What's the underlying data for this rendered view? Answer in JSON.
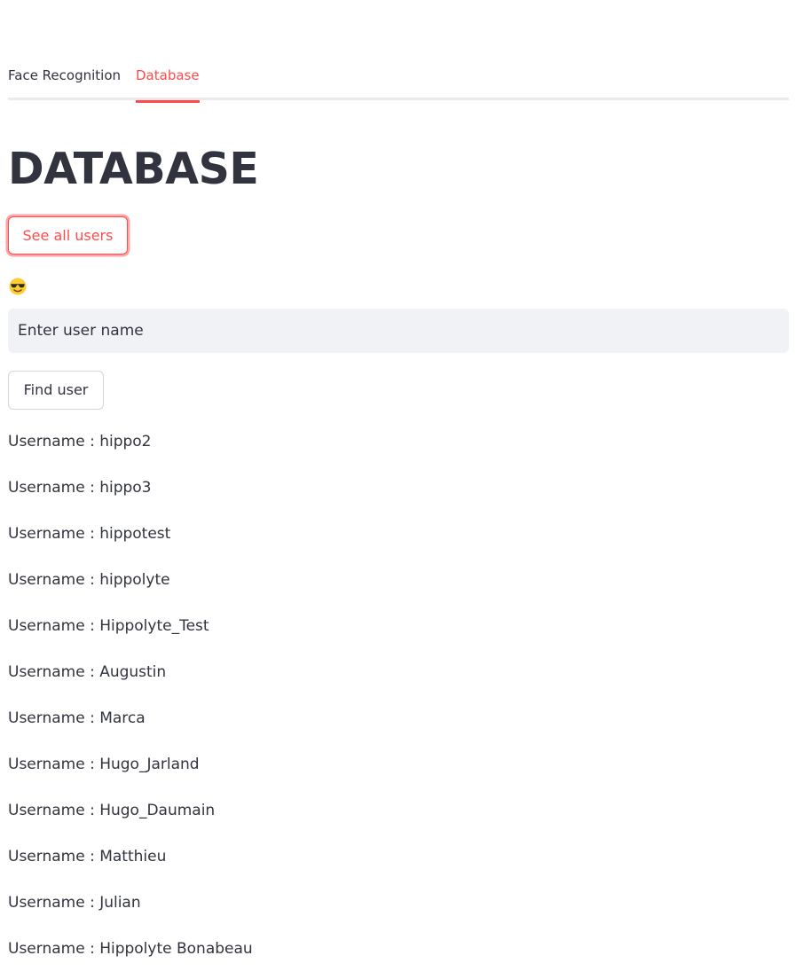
{
  "tabs": [
    {
      "label": "Face Recognition",
      "active": false
    },
    {
      "label": "Database",
      "active": true
    }
  ],
  "page": {
    "title": "DATABASE",
    "see_all_label": "See all users",
    "status_emoji_icon": "sunglasses-face-icon",
    "search_placeholder": "Enter user name",
    "search_value": "",
    "find_label": "Find user"
  },
  "users": [
    "Username : hippo2",
    "Username : hippo3",
    "Username : hippotest",
    "Username : hippolyte",
    "Username : Hippolyte_Test",
    "Username : Augustin",
    "Username : Marca",
    "Username : Hugo_Jarland",
    "Username : Hugo_Daumain",
    "Username : Matthieu",
    "Username : Julian",
    "Username : Hippolyte Bonabeau"
  ],
  "colors": {
    "accent": "#ff4b4b",
    "text": "#31333f",
    "input_bg": "#f0f2f6"
  }
}
